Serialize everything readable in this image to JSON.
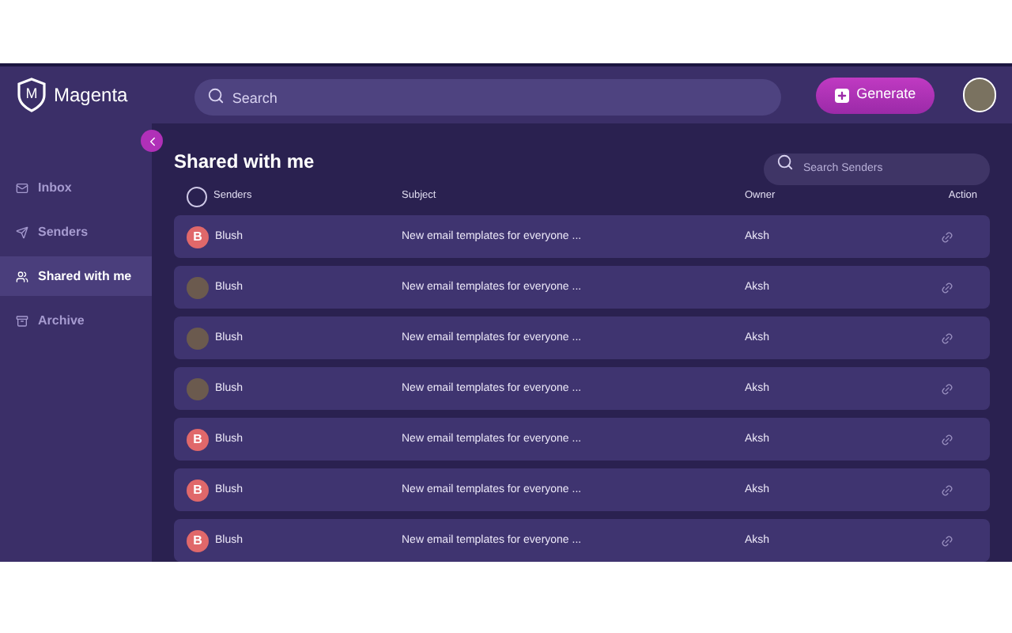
{
  "brand": {
    "name": "Magenta",
    "letter": "M"
  },
  "search": {
    "placeholder": "Search"
  },
  "generate_button": {
    "label": "Generate"
  },
  "sidebar": {
    "items": [
      {
        "label": "Inbox",
        "selected": false
      },
      {
        "label": "Senders",
        "selected": false
      },
      {
        "label": "Shared with me",
        "selected": true
      },
      {
        "label": "Archive",
        "selected": false
      }
    ]
  },
  "page_title": "Shared with me",
  "sender_search": {
    "placeholder": "Search Senders"
  },
  "table": {
    "select_all_checked": false,
    "columns": [
      "Senders",
      "Subject",
      "Owner",
      "Action"
    ],
    "rows": [
      {
        "avatar": {
          "kind": "letter",
          "text": "B"
        },
        "sender": "Blush",
        "subject": "New email templates for everyone ...",
        "owner": "Aksh"
      },
      {
        "avatar": {
          "kind": "photo"
        },
        "sender": "Blush",
        "subject": "New email templates for everyone ...",
        "owner": "Aksh"
      },
      {
        "avatar": {
          "kind": "photo"
        },
        "sender": "Blush",
        "subject": "New email templates for everyone ...",
        "owner": "Aksh"
      },
      {
        "avatar": {
          "kind": "photo"
        },
        "sender": "Blush",
        "subject": "New email templates for everyone ...",
        "owner": "Aksh"
      },
      {
        "avatar": {
          "kind": "letter",
          "text": "B"
        },
        "sender": "Blush",
        "subject": "New email templates for everyone ...",
        "owner": "Aksh"
      },
      {
        "avatar": {
          "kind": "letter",
          "text": "B"
        },
        "sender": "Blush",
        "subject": "New email templates for everyone ...",
        "owner": "Aksh"
      },
      {
        "avatar": {
          "kind": "letter",
          "text": "B"
        },
        "sender": "Blush",
        "subject": "New email templates for everyone ...",
        "owner": "Aksh"
      }
    ]
  }
}
